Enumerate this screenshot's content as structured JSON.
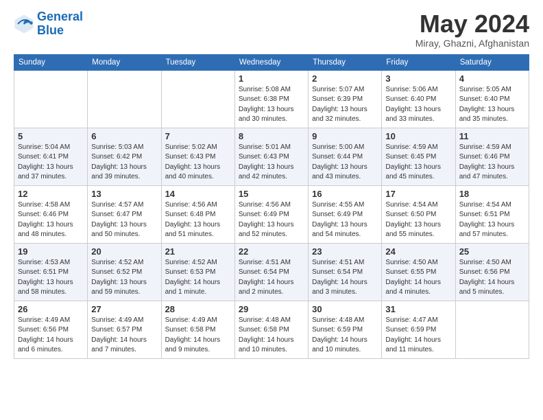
{
  "logo": {
    "line1": "General",
    "line2": "Blue"
  },
  "title": "May 2024",
  "subtitle": "Miray, Ghazni, Afghanistan",
  "days_of_week": [
    "Sunday",
    "Monday",
    "Tuesday",
    "Wednesday",
    "Thursday",
    "Friday",
    "Saturday"
  ],
  "weeks": [
    [
      {
        "day": "",
        "info": ""
      },
      {
        "day": "",
        "info": ""
      },
      {
        "day": "",
        "info": ""
      },
      {
        "day": "1",
        "info": "Sunrise: 5:08 AM\nSunset: 6:38 PM\nDaylight: 13 hours\nand 30 minutes."
      },
      {
        "day": "2",
        "info": "Sunrise: 5:07 AM\nSunset: 6:39 PM\nDaylight: 13 hours\nand 32 minutes."
      },
      {
        "day": "3",
        "info": "Sunrise: 5:06 AM\nSunset: 6:40 PM\nDaylight: 13 hours\nand 33 minutes."
      },
      {
        "day": "4",
        "info": "Sunrise: 5:05 AM\nSunset: 6:40 PM\nDaylight: 13 hours\nand 35 minutes."
      }
    ],
    [
      {
        "day": "5",
        "info": "Sunrise: 5:04 AM\nSunset: 6:41 PM\nDaylight: 13 hours\nand 37 minutes."
      },
      {
        "day": "6",
        "info": "Sunrise: 5:03 AM\nSunset: 6:42 PM\nDaylight: 13 hours\nand 39 minutes."
      },
      {
        "day": "7",
        "info": "Sunrise: 5:02 AM\nSunset: 6:43 PM\nDaylight: 13 hours\nand 40 minutes."
      },
      {
        "day": "8",
        "info": "Sunrise: 5:01 AM\nSunset: 6:43 PM\nDaylight: 13 hours\nand 42 minutes."
      },
      {
        "day": "9",
        "info": "Sunrise: 5:00 AM\nSunset: 6:44 PM\nDaylight: 13 hours\nand 43 minutes."
      },
      {
        "day": "10",
        "info": "Sunrise: 4:59 AM\nSunset: 6:45 PM\nDaylight: 13 hours\nand 45 minutes."
      },
      {
        "day": "11",
        "info": "Sunrise: 4:59 AM\nSunset: 6:46 PM\nDaylight: 13 hours\nand 47 minutes."
      }
    ],
    [
      {
        "day": "12",
        "info": "Sunrise: 4:58 AM\nSunset: 6:46 PM\nDaylight: 13 hours\nand 48 minutes."
      },
      {
        "day": "13",
        "info": "Sunrise: 4:57 AM\nSunset: 6:47 PM\nDaylight: 13 hours\nand 50 minutes."
      },
      {
        "day": "14",
        "info": "Sunrise: 4:56 AM\nSunset: 6:48 PM\nDaylight: 13 hours\nand 51 minutes."
      },
      {
        "day": "15",
        "info": "Sunrise: 4:56 AM\nSunset: 6:49 PM\nDaylight: 13 hours\nand 52 minutes."
      },
      {
        "day": "16",
        "info": "Sunrise: 4:55 AM\nSunset: 6:49 PM\nDaylight: 13 hours\nand 54 minutes."
      },
      {
        "day": "17",
        "info": "Sunrise: 4:54 AM\nSunset: 6:50 PM\nDaylight: 13 hours\nand 55 minutes."
      },
      {
        "day": "18",
        "info": "Sunrise: 4:54 AM\nSunset: 6:51 PM\nDaylight: 13 hours\nand 57 minutes."
      }
    ],
    [
      {
        "day": "19",
        "info": "Sunrise: 4:53 AM\nSunset: 6:51 PM\nDaylight: 13 hours\nand 58 minutes."
      },
      {
        "day": "20",
        "info": "Sunrise: 4:52 AM\nSunset: 6:52 PM\nDaylight: 13 hours\nand 59 minutes."
      },
      {
        "day": "21",
        "info": "Sunrise: 4:52 AM\nSunset: 6:53 PM\nDaylight: 14 hours\nand 1 minute."
      },
      {
        "day": "22",
        "info": "Sunrise: 4:51 AM\nSunset: 6:54 PM\nDaylight: 14 hours\nand 2 minutes."
      },
      {
        "day": "23",
        "info": "Sunrise: 4:51 AM\nSunset: 6:54 PM\nDaylight: 14 hours\nand 3 minutes."
      },
      {
        "day": "24",
        "info": "Sunrise: 4:50 AM\nSunset: 6:55 PM\nDaylight: 14 hours\nand 4 minutes."
      },
      {
        "day": "25",
        "info": "Sunrise: 4:50 AM\nSunset: 6:56 PM\nDaylight: 14 hours\nand 5 minutes."
      }
    ],
    [
      {
        "day": "26",
        "info": "Sunrise: 4:49 AM\nSunset: 6:56 PM\nDaylight: 14 hours\nand 6 minutes."
      },
      {
        "day": "27",
        "info": "Sunrise: 4:49 AM\nSunset: 6:57 PM\nDaylight: 14 hours\nand 7 minutes."
      },
      {
        "day": "28",
        "info": "Sunrise: 4:49 AM\nSunset: 6:58 PM\nDaylight: 14 hours\nand 9 minutes."
      },
      {
        "day": "29",
        "info": "Sunrise: 4:48 AM\nSunset: 6:58 PM\nDaylight: 14 hours\nand 10 minutes."
      },
      {
        "day": "30",
        "info": "Sunrise: 4:48 AM\nSunset: 6:59 PM\nDaylight: 14 hours\nand 10 minutes."
      },
      {
        "day": "31",
        "info": "Sunrise: 4:47 AM\nSunset: 6:59 PM\nDaylight: 14 hours\nand 11 minutes."
      },
      {
        "day": "",
        "info": ""
      }
    ]
  ]
}
